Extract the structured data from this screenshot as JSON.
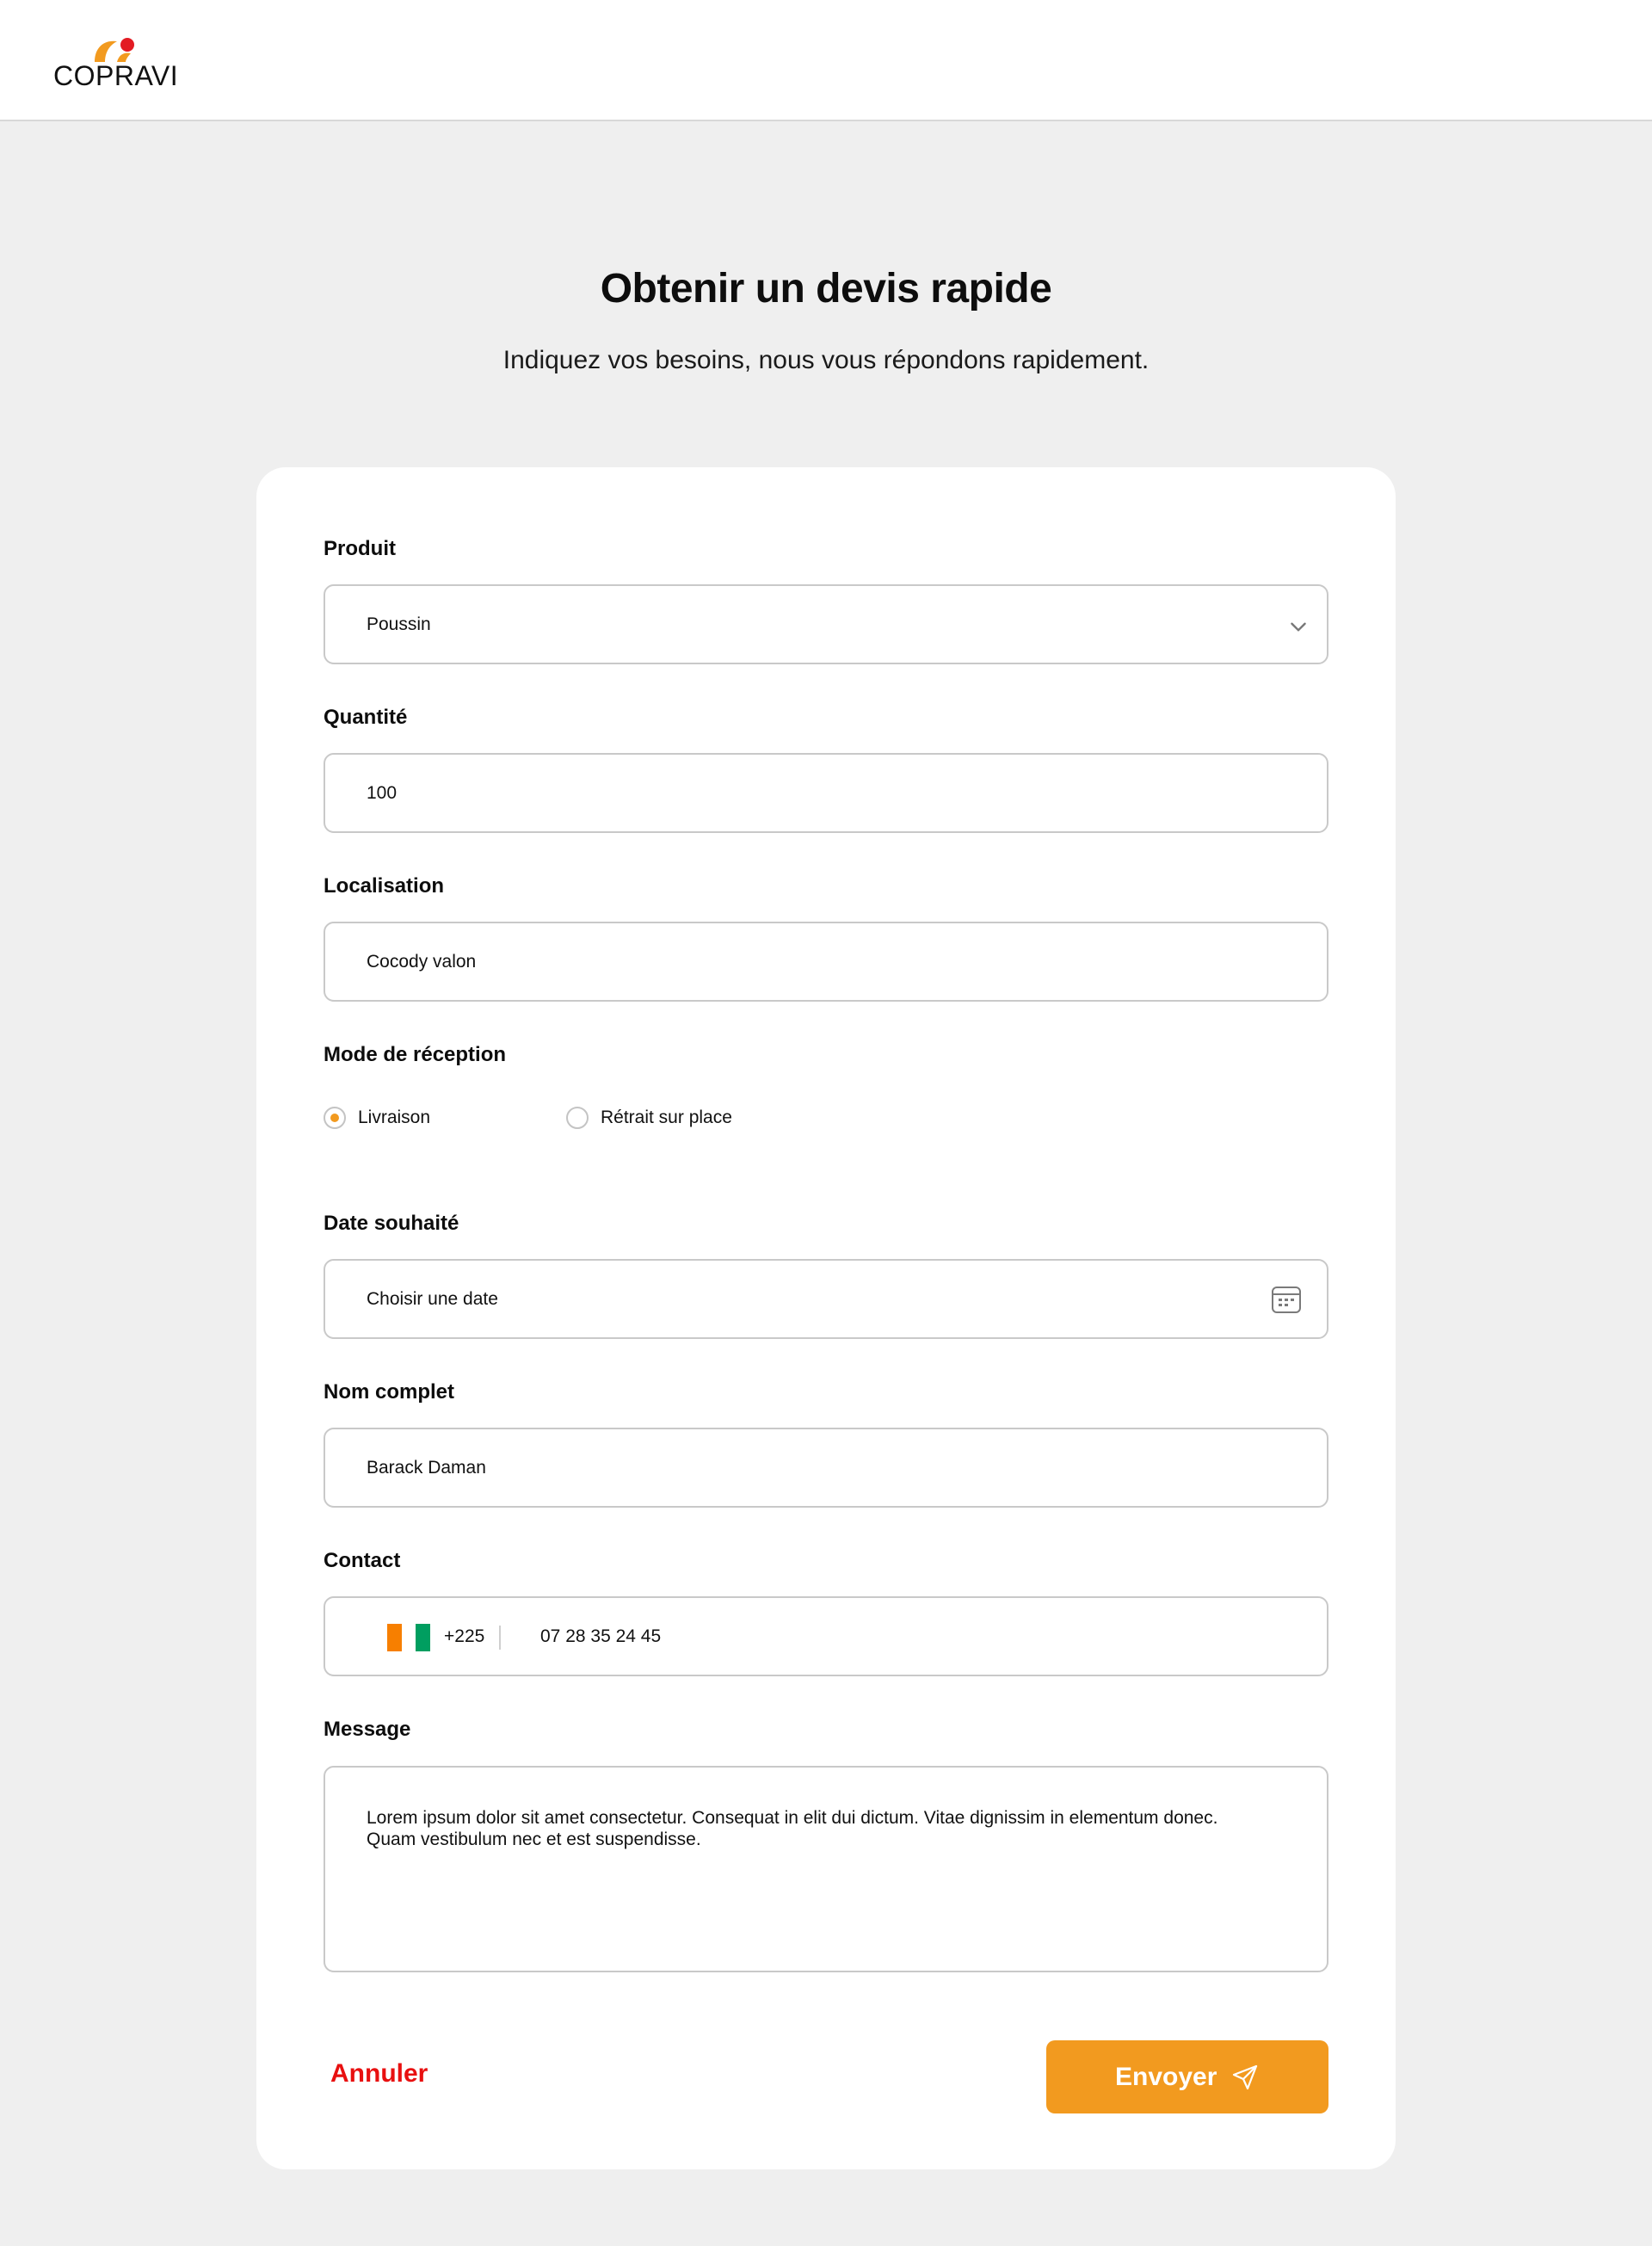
{
  "header": {
    "logo_text": "COPRAVI"
  },
  "hero": {
    "title": "Obtenir un devis rapide",
    "subtitle": "Indiquez vos besoins, nous vous répondons rapidement."
  },
  "form": {
    "product": {
      "label": "Produit",
      "value": "Poussin"
    },
    "quantity": {
      "label": "Quantité",
      "value": "100"
    },
    "location": {
      "label": "Localisation",
      "value": "Cocody valon"
    },
    "reception_mode": {
      "label": "Mode de réception",
      "options": [
        {
          "label": "Livraison",
          "checked": true
        },
        {
          "label": "Rétrait sur place",
          "checked": false
        }
      ]
    },
    "date": {
      "label": "Date souhaité",
      "placeholder": "Choisir une date"
    },
    "full_name": {
      "label": "Nom complet",
      "value": "Barack Daman"
    },
    "contact": {
      "label": "Contact",
      "flag_colors": [
        "#f77f00",
        "#ffffff",
        "#009e60"
      ],
      "dial_code": "+225",
      "value": "07 28 35 24 45"
    },
    "message": {
      "label": "Message",
      "value": "Lorem ipsum dolor sit amet consectetur. Consequat in elit dui dictum. Vitae dignissim in elementum donec. Quam vestibulum nec et est suspendisse."
    },
    "actions": {
      "cancel_label": "Annuler",
      "submit_label": "Envoyer"
    }
  },
  "colors": {
    "accent": "#f29a1f",
    "cancel": "#e81010",
    "background": "#efefef"
  },
  "icons": {
    "select": "chevron-down-icon",
    "date": "calendar-icon",
    "submit": "send-icon"
  }
}
